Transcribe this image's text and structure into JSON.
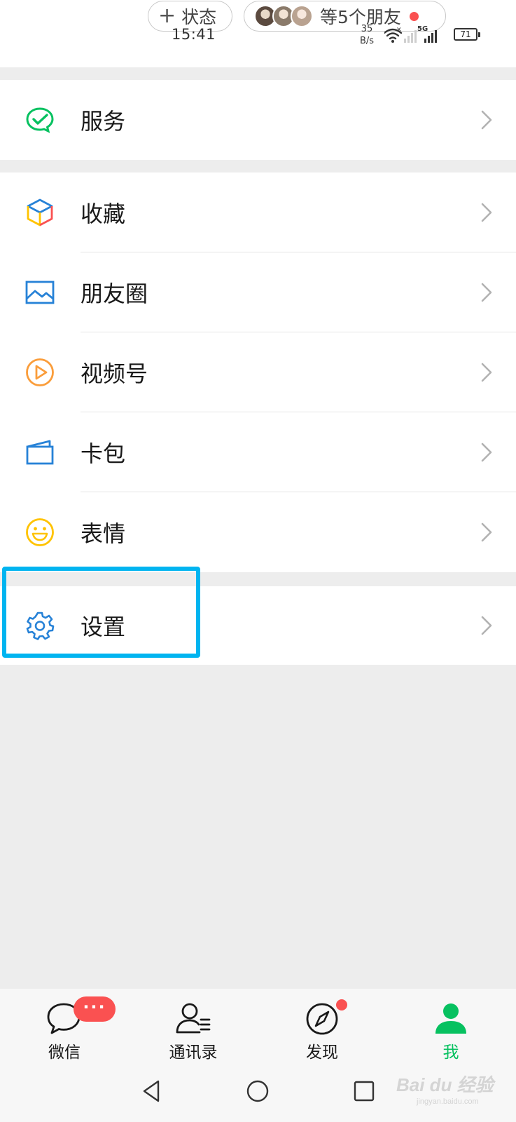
{
  "status_bar": {
    "add_status_plus": "+",
    "add_status_label": "状态",
    "friends_label": "等5个朋友",
    "time": "15:41",
    "net_speed_value": "35",
    "net_speed_unit": "B/s",
    "signal_label": "5G",
    "battery_level": "71"
  },
  "menu": {
    "group1": [
      {
        "label": "服务",
        "icon": "wechat-pay-icon"
      }
    ],
    "group2": [
      {
        "label": "收藏",
        "icon": "favorites-cube-icon"
      },
      {
        "label": "朋友圈",
        "icon": "moments-picture-icon"
      },
      {
        "label": "视频号",
        "icon": "channels-play-icon"
      },
      {
        "label": "卡包",
        "icon": "card-wallet-icon"
      },
      {
        "label": "表情",
        "icon": "sticker-smiley-icon"
      }
    ],
    "group3": [
      {
        "label": "设置",
        "icon": "settings-gear-icon"
      }
    ]
  },
  "tabbar": {
    "tabs": [
      {
        "label": "微信",
        "icon": "chat-bubble-icon"
      },
      {
        "label": "通讯录",
        "icon": "contacts-icon"
      },
      {
        "label": "发现",
        "icon": "discover-compass-icon"
      },
      {
        "label": "我",
        "icon": "me-person-icon"
      }
    ],
    "active_tab": "我",
    "chat_badge": "···"
  },
  "watermark": {
    "brand": "Bai du 经验",
    "url": "jingyan.baidu.com"
  },
  "colors": {
    "brand_green": "#07c160",
    "badge_red": "#fa5151",
    "highlight_blue": "#00b4f0",
    "page_bg": "#ededed"
  }
}
